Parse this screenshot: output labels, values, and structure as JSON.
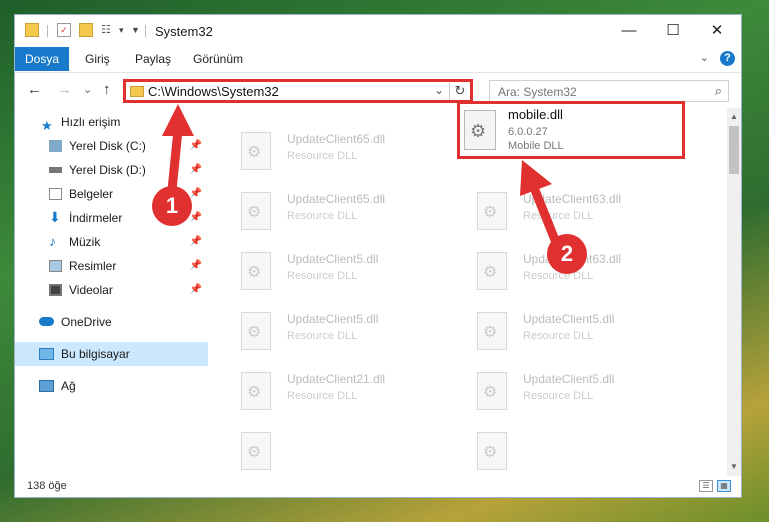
{
  "window": {
    "title": "System32",
    "controls": [
      "—",
      "☐",
      "✕"
    ]
  },
  "ribbon": {
    "file_tab": "Dosya",
    "tabs": [
      "Giriş",
      "Paylaş",
      "Görünüm"
    ],
    "help": "?"
  },
  "navigation": {
    "back": "←",
    "forward": "→",
    "history": "⌄",
    "up": "↑"
  },
  "address": {
    "path": "C:\\Windows\\System32",
    "dropdown": "⌄",
    "refresh": "↻"
  },
  "search": {
    "placeholder": "Ara: System32"
  },
  "sidebar": {
    "items": [
      {
        "label": "Hızlı erişim",
        "icon": "star-icon"
      },
      {
        "label": "Yerel Disk (C:)",
        "icon": "drive-icon",
        "pinned": true
      },
      {
        "label": "Yerel Disk (D:)",
        "icon": "drive-icon",
        "pinned": true
      },
      {
        "label": "Belgeler",
        "icon": "document-icon",
        "pinned": true
      },
      {
        "label": "İndirmeler",
        "icon": "download-icon",
        "pinned": true
      },
      {
        "label": "Müzik",
        "icon": "music-icon",
        "pinned": true
      },
      {
        "label": "Resimler",
        "icon": "picture-icon",
        "pinned": true
      },
      {
        "label": "Videolar",
        "icon": "video-icon",
        "pinned": true
      },
      {
        "label": "OneDrive",
        "icon": "cloud-icon"
      },
      {
        "label": "Bu bilgisayar",
        "icon": "computer-icon",
        "selected": true
      },
      {
        "label": "Ağ",
        "icon": "network-icon"
      }
    ]
  },
  "files": [
    {
      "name": "UpdateClient65.dll",
      "desc": "Resource DLL"
    },
    {
      "name": "UpdateClient65.dll",
      "desc": "Resource DLL"
    },
    {
      "name": "UpdateClient63.dll",
      "desc": "Resource DLL"
    },
    {
      "name": "UpdateClient5.dll",
      "desc": "Resource DLL"
    },
    {
      "name": "UpdateClient63.dll",
      "desc": "Resource DLL"
    },
    {
      "name": "UpdateClient5.dll",
      "desc": "Resource DLL"
    },
    {
      "name": "UpdateClient5.dll",
      "desc": "Resource DLL"
    },
    {
      "name": "UpdateClient21.dll",
      "desc": "Resource DLL"
    },
    {
      "name": "UpdateClient5.dll",
      "desc": "Resource DLL"
    }
  ],
  "highlighted_file": {
    "name": "mobile.dll",
    "version": "6.0.0.27",
    "desc": "Mobile DLL"
  },
  "status": {
    "count": "138 öğe"
  },
  "annotations": {
    "step1": "1",
    "step2": "2",
    "color": "#e0302f"
  }
}
